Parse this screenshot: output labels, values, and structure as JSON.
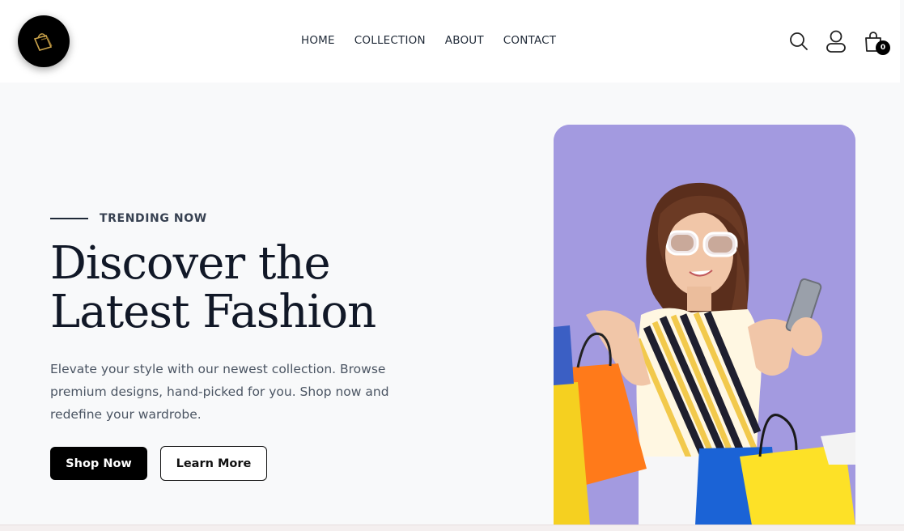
{
  "brand": {
    "logo_name": "brand-logo"
  },
  "nav": {
    "items": [
      {
        "label": "HOME"
      },
      {
        "label": "COLLECTION"
      },
      {
        "label": "ABOUT"
      },
      {
        "label": "CONTACT"
      }
    ]
  },
  "header": {
    "icons": [
      "search-icon",
      "user-icon",
      "shopping-bag-icon"
    ],
    "cart_count": "0"
  },
  "hero": {
    "eyebrow": "TRENDING NOW",
    "headline_line1": "Discover the",
    "headline_line2": "Latest Fashion",
    "description": "Elevate your style with our newest collection. Browse premium designs, hand-picked for you. Shop now and redefine your wardrobe.",
    "primary_cta": "Shop Now",
    "secondary_cta": "Learn More",
    "image_alt": "Woman with shopping bags and phone",
    "image_bg": "#a39ae0"
  },
  "colors": {
    "accent": "#000000",
    "background": "#f8f9fa",
    "logo_gold": "#c9a24a"
  }
}
